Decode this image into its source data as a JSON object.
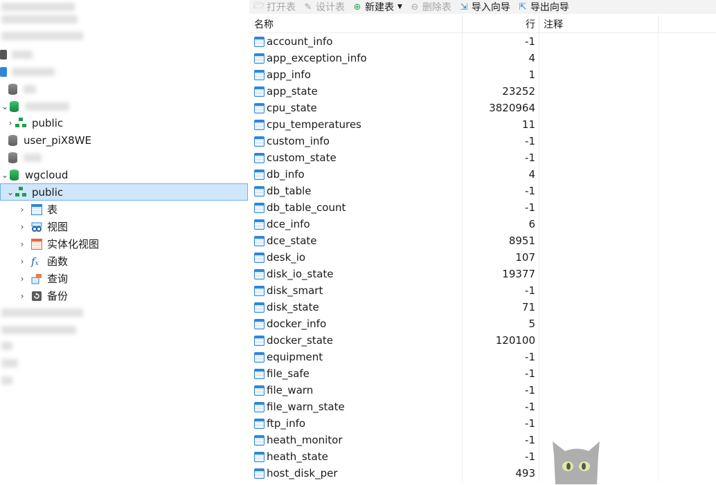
{
  "tree": {
    "items": [
      {
        "label": "public",
        "indent": 2,
        "expand": "›",
        "icon": "schema-icon",
        "selected": false
      },
      {
        "label": "user_piX8WE",
        "indent": 1,
        "expand": "",
        "icon": "database-gray-icon",
        "selected": false
      },
      {
        "label": "wgcloud",
        "indent": 1,
        "expand": "⌄",
        "icon": "database-green-icon",
        "selected": false
      },
      {
        "label": "public",
        "indent": 2,
        "expand": "⌄",
        "icon": "schema-icon",
        "selected": true
      },
      {
        "label": "表",
        "indent": 3,
        "expand": "›",
        "icon": "table-icon",
        "selected": false
      },
      {
        "label": "视图",
        "indent": 3,
        "expand": "›",
        "icon": "view-icon",
        "selected": false
      },
      {
        "label": "实体化视图",
        "indent": 3,
        "expand": "›",
        "icon": "materialized-view-icon",
        "selected": false
      },
      {
        "label": "函数",
        "indent": 3,
        "expand": "›",
        "icon": "function-icon",
        "selected": false
      },
      {
        "label": "查询",
        "indent": 3,
        "expand": "›",
        "icon": "query-icon",
        "selected": false
      },
      {
        "label": "备份",
        "indent": 3,
        "expand": "›",
        "icon": "backup-icon",
        "selected": false
      }
    ]
  },
  "toolbar": {
    "open_table": "打开表",
    "design_table": "设计表",
    "new_table": "新建表",
    "delete_table": "删除表",
    "import_wizard": "导入向导",
    "export_wizard": "导出向导"
  },
  "grid": {
    "headers": {
      "name": "名称",
      "rows": "行",
      "comment": "注释"
    },
    "rows": [
      {
        "name": "account_info",
        "rows": "-1"
      },
      {
        "name": "app_exception_info",
        "rows": "4"
      },
      {
        "name": "app_info",
        "rows": "1"
      },
      {
        "name": "app_state",
        "rows": "23252"
      },
      {
        "name": "cpu_state",
        "rows": "3820964"
      },
      {
        "name": "cpu_temperatures",
        "rows": "11"
      },
      {
        "name": "custom_info",
        "rows": "-1"
      },
      {
        "name": "custom_state",
        "rows": "-1"
      },
      {
        "name": "db_info",
        "rows": "4"
      },
      {
        "name": "db_table",
        "rows": "-1"
      },
      {
        "name": "db_table_count",
        "rows": "-1"
      },
      {
        "name": "dce_info",
        "rows": "6"
      },
      {
        "name": "dce_state",
        "rows": "8951"
      },
      {
        "name": "desk_io",
        "rows": "107"
      },
      {
        "name": "disk_io_state",
        "rows": "19377"
      },
      {
        "name": "disk_smart",
        "rows": "-1"
      },
      {
        "name": "disk_state",
        "rows": "71"
      },
      {
        "name": "docker_info",
        "rows": "5"
      },
      {
        "name": "docker_state",
        "rows": "120100"
      },
      {
        "name": "equipment",
        "rows": "-1"
      },
      {
        "name": "file_safe",
        "rows": "-1"
      },
      {
        "name": "file_warn",
        "rows": "-1"
      },
      {
        "name": "file_warn_state",
        "rows": "-1"
      },
      {
        "name": "ftp_info",
        "rows": "-1"
      },
      {
        "name": "heath_monitor",
        "rows": "-1"
      },
      {
        "name": "heath_state",
        "rows": "-1"
      },
      {
        "name": "host_disk_per",
        "rows": "493"
      }
    ]
  },
  "colors": {
    "selection_bg": "#cfe6fb",
    "selection_border": "#6fb2ef",
    "db_green": "#1fa853",
    "table_icon_blue": "#2f86d8"
  }
}
